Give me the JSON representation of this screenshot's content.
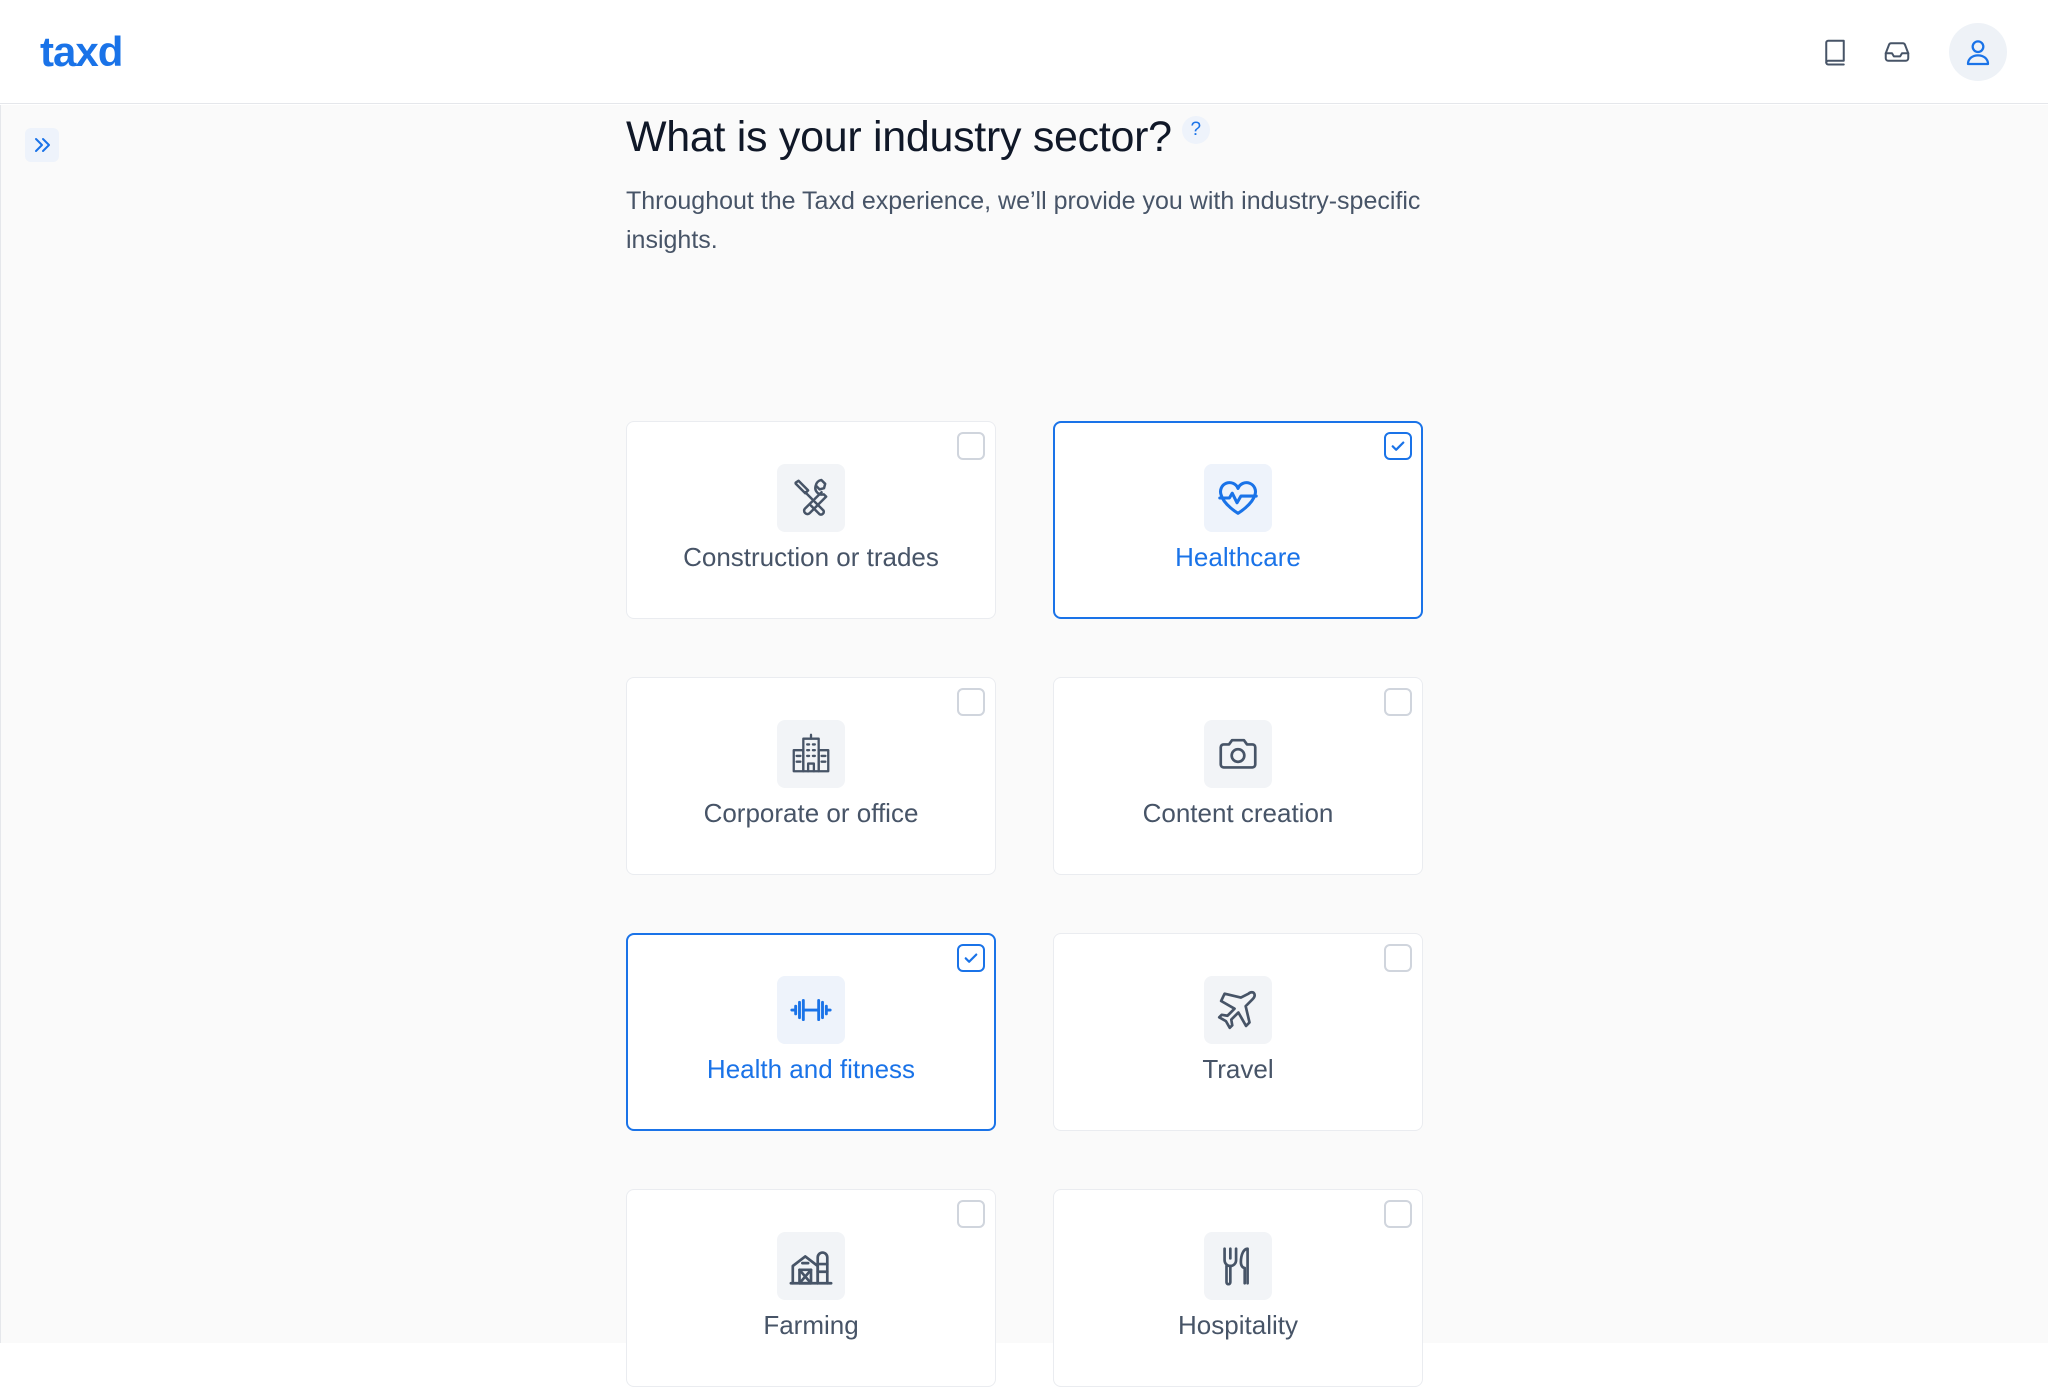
{
  "app": {
    "logo": "taxd",
    "icons": [
      "book-icon",
      "inbox-icon",
      "user-icon"
    ],
    "accent_color": "#1a73e8"
  },
  "sidebar": {
    "toggle_icon": "chevrons-right-icon"
  },
  "question": {
    "title": "What is your industry sector?",
    "help_label": "?",
    "subtitle": "Throughout the Taxd experience, we’ll provide you with industry-specific insights."
  },
  "sectors": [
    {
      "label": "Construction or trades",
      "icon": "tools-icon",
      "selected": false
    },
    {
      "label": "Healthcare",
      "icon": "heart-pulse-icon",
      "selected": true
    },
    {
      "label": "Corporate or office",
      "icon": "building-icon",
      "selected": false
    },
    {
      "label": "Content creation",
      "icon": "camera-icon",
      "selected": false
    },
    {
      "label": "Health and fitness",
      "icon": "dumbbell-icon",
      "selected": true
    },
    {
      "label": "Travel",
      "icon": "plane-icon",
      "selected": false
    },
    {
      "label": "Farming",
      "icon": "barn-icon",
      "selected": false
    },
    {
      "label": "Hospitality",
      "icon": "cutlery-icon",
      "selected": false
    }
  ]
}
